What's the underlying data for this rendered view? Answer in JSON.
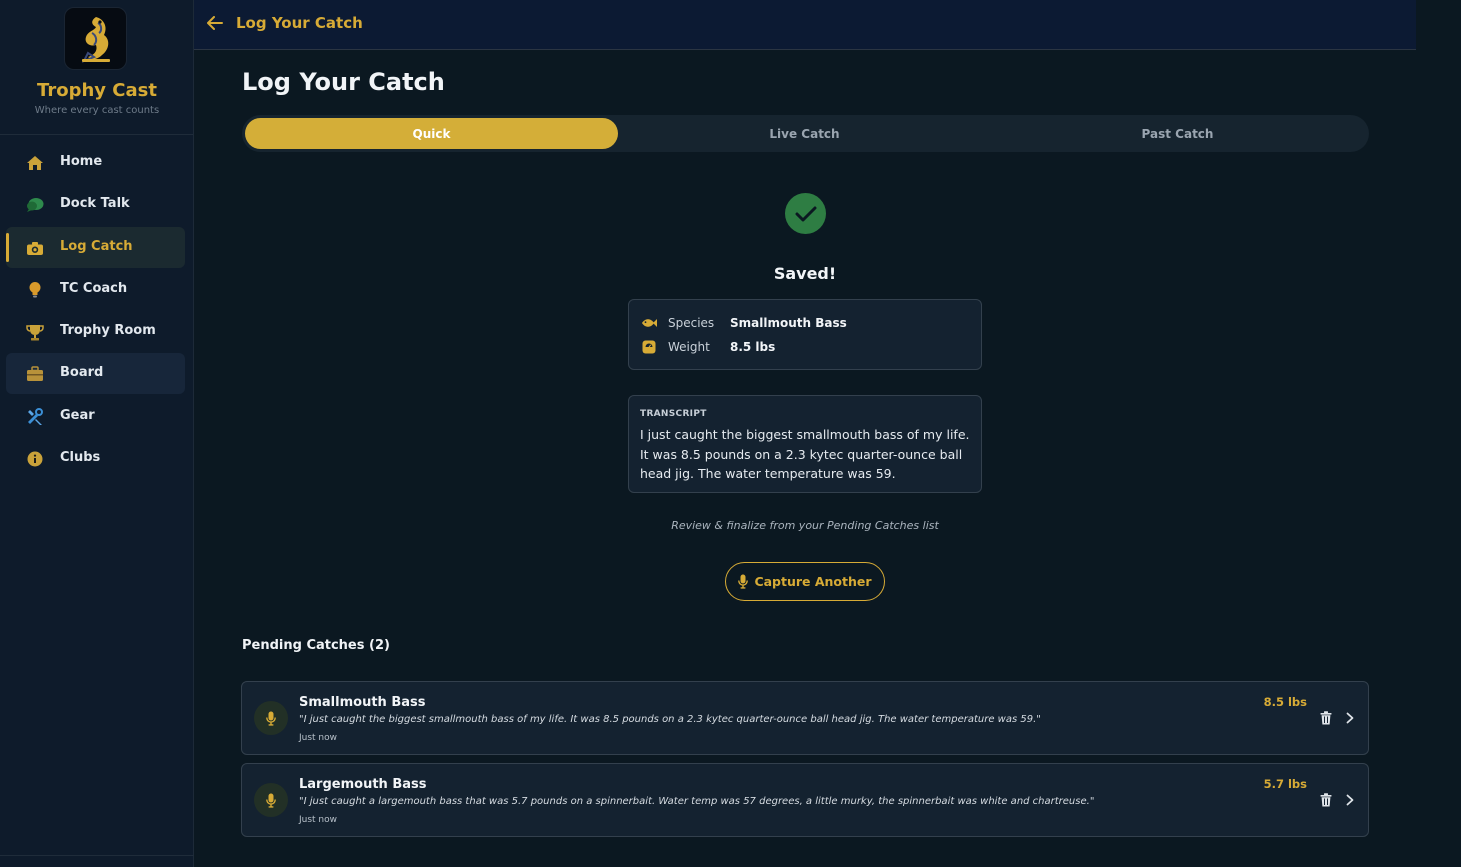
{
  "brand": {
    "name": "Trophy Cast",
    "tagline": "Where every cast counts"
  },
  "sidebar": {
    "items": [
      {
        "label": "Home",
        "icon": "home-icon"
      },
      {
        "label": "Dock Talk",
        "icon": "chat-bubbles-icon"
      },
      {
        "label": "Log Catch",
        "icon": "camera-icon",
        "active": true
      },
      {
        "label": "TC Coach",
        "icon": "lightbulb-icon"
      },
      {
        "label": "Trophy Room",
        "icon": "trophy-icon"
      },
      {
        "label": "Board",
        "icon": "briefcase-icon"
      },
      {
        "label": "Gear",
        "icon": "tools-icon"
      },
      {
        "label": "Clubs",
        "icon": "info-icon"
      }
    ]
  },
  "topbar": {
    "title": "Log Your Catch"
  },
  "page": {
    "title": "Log Your Catch"
  },
  "tabs": [
    {
      "label": "Quick",
      "selected": true
    },
    {
      "label": "Live Catch",
      "selected": false
    },
    {
      "label": "Past Catch",
      "selected": false
    }
  ],
  "result": {
    "status": "Saved!",
    "species_label": "Species",
    "species_value": "Smallmouth Bass",
    "weight_label": "Weight",
    "weight_value": "8.5 lbs"
  },
  "transcript": {
    "label": "TRANSCRIPT",
    "text": "I just caught the biggest smallmouth bass of my life. It was 8.5 pounds on a 2.3 kytec quarter-ounce ball head jig. The water temperature was 59."
  },
  "review_note": "Review & finalize from your Pending Catches list",
  "capture_button": "Capture Another",
  "pending": {
    "title": "Pending Catches (2)",
    "items": [
      {
        "species": "Smallmouth Bass",
        "quote": "\"I just caught the biggest smallmouth bass of my life. It was 8.5 pounds on a 2.3 kytec quarter-ounce ball head jig. The water temperature was 59.\"",
        "time": "Just now",
        "weight": "8.5 lbs"
      },
      {
        "species": "Largemouth Bass",
        "quote": "\"I just caught a largemouth bass that was 5.7 pounds on a spinnerbait. Water temp was 57 degrees, a little murky, the spinnerbait was white and chartreuse.\"",
        "time": "Just now",
        "weight": "5.7 lbs"
      }
    ]
  },
  "colors": {
    "accent": "#d7ab36",
    "success": "#2e7d43",
    "background": "#0b1821",
    "sidebar": "#0e1b2b"
  }
}
